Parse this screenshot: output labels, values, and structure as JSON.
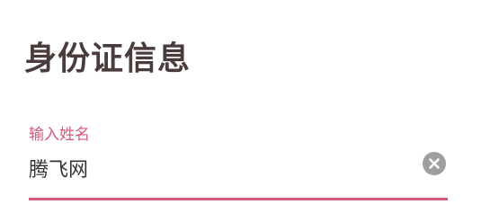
{
  "page": {
    "title": "身份证信息"
  },
  "name_field": {
    "label": "输入姓名",
    "value": "腾飞网",
    "clear_icon": "close-circle-icon"
  },
  "colors": {
    "accent": "#d35a7a",
    "title_text": "#4a3c3c",
    "input_text": "#333333",
    "clear_icon_bg": "#a19e9e"
  }
}
